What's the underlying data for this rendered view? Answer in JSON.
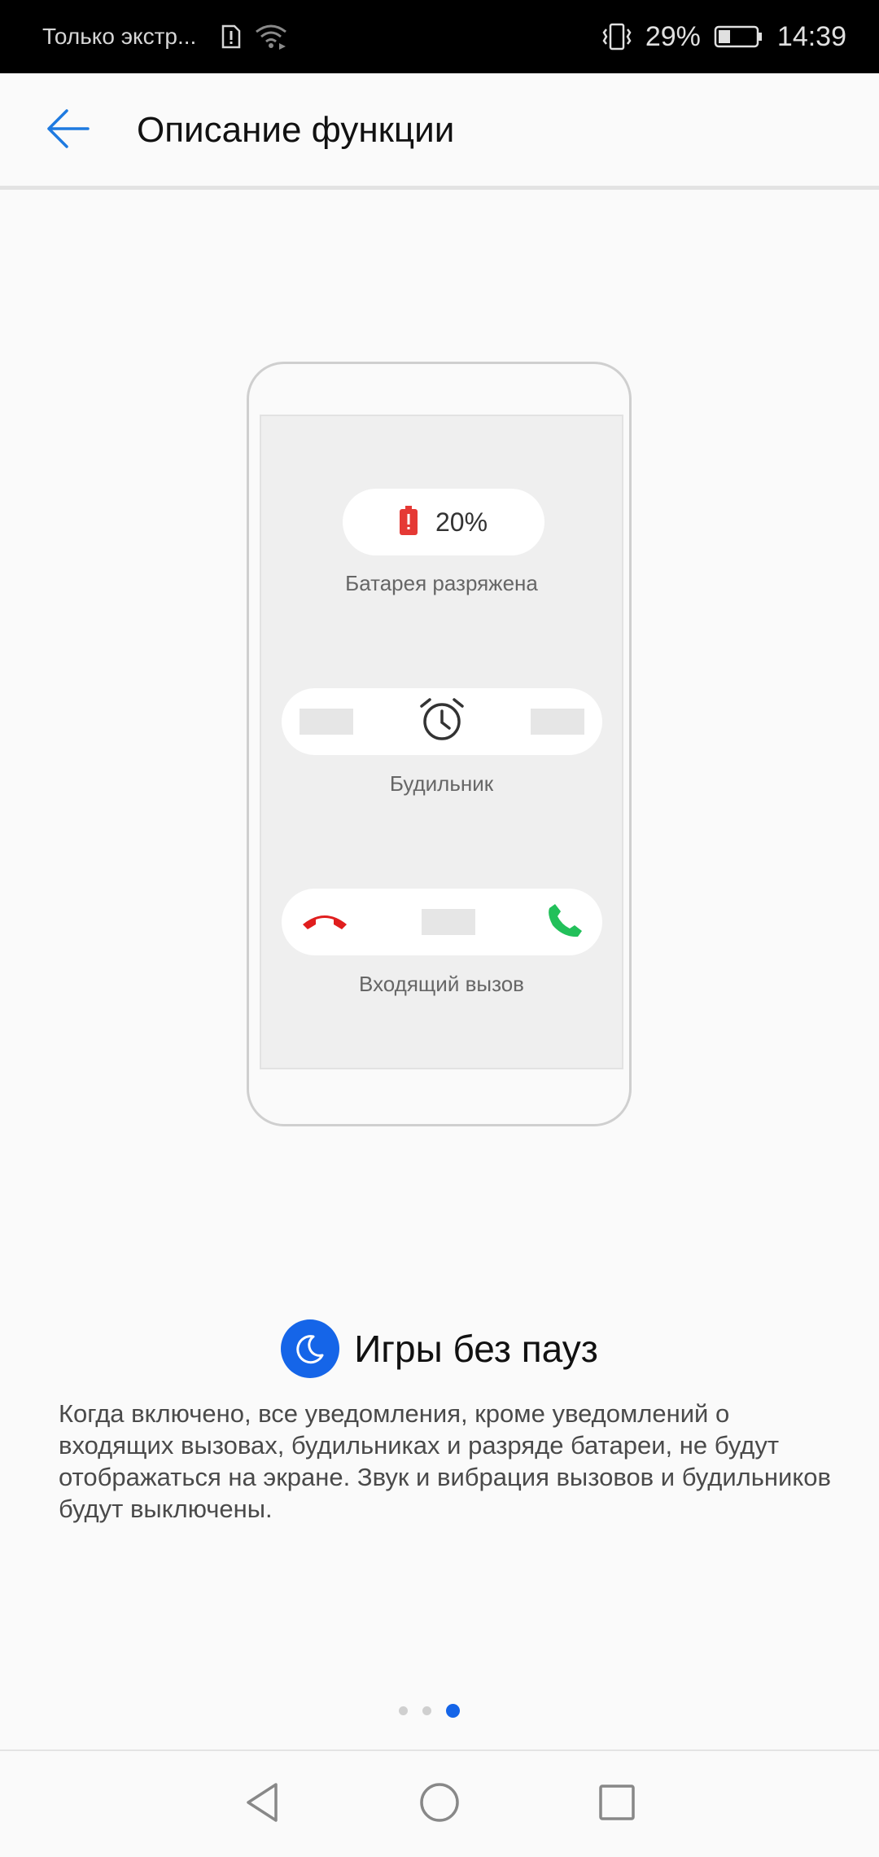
{
  "status_bar": {
    "carrier_text": "Только экстр...",
    "battery_percent": "29%",
    "time": "14:39",
    "icons": [
      "sim-alert-icon",
      "wifi-icon",
      "vibrate-icon",
      "battery-icon"
    ]
  },
  "app_bar": {
    "back_icon": "back-arrow-icon",
    "title": "Описание функции"
  },
  "illustration": {
    "battery_value": "20%",
    "battery_caption": "Батарея разряжена",
    "alarm_caption": "Будильник",
    "call_caption": "Входящий вызов",
    "icons": [
      "battery-alert-icon",
      "alarm-clock-icon",
      "decline-call-icon",
      "accept-call-icon"
    ]
  },
  "feature": {
    "icon": "moon-icon",
    "title": "Игры без пауз",
    "description": "Когда включено, все уведомления, кроме уведомлений о входящих вызовах, будильниках и разряде батареи, не будут отображаться на экране. Звук и вибрация вызовов и будильников будут выключены."
  },
  "pager": {
    "count": 3,
    "active": 3
  },
  "navigation": {
    "icons": [
      "nav-back-icon",
      "nav-home-icon",
      "nav-recents-icon"
    ]
  },
  "colors": {
    "accent": "#1565e8",
    "battery_red": "#e53935",
    "decline_red": "#e01e1e",
    "accept_green": "#22c05a",
    "status_bar_bg": "#000000"
  }
}
